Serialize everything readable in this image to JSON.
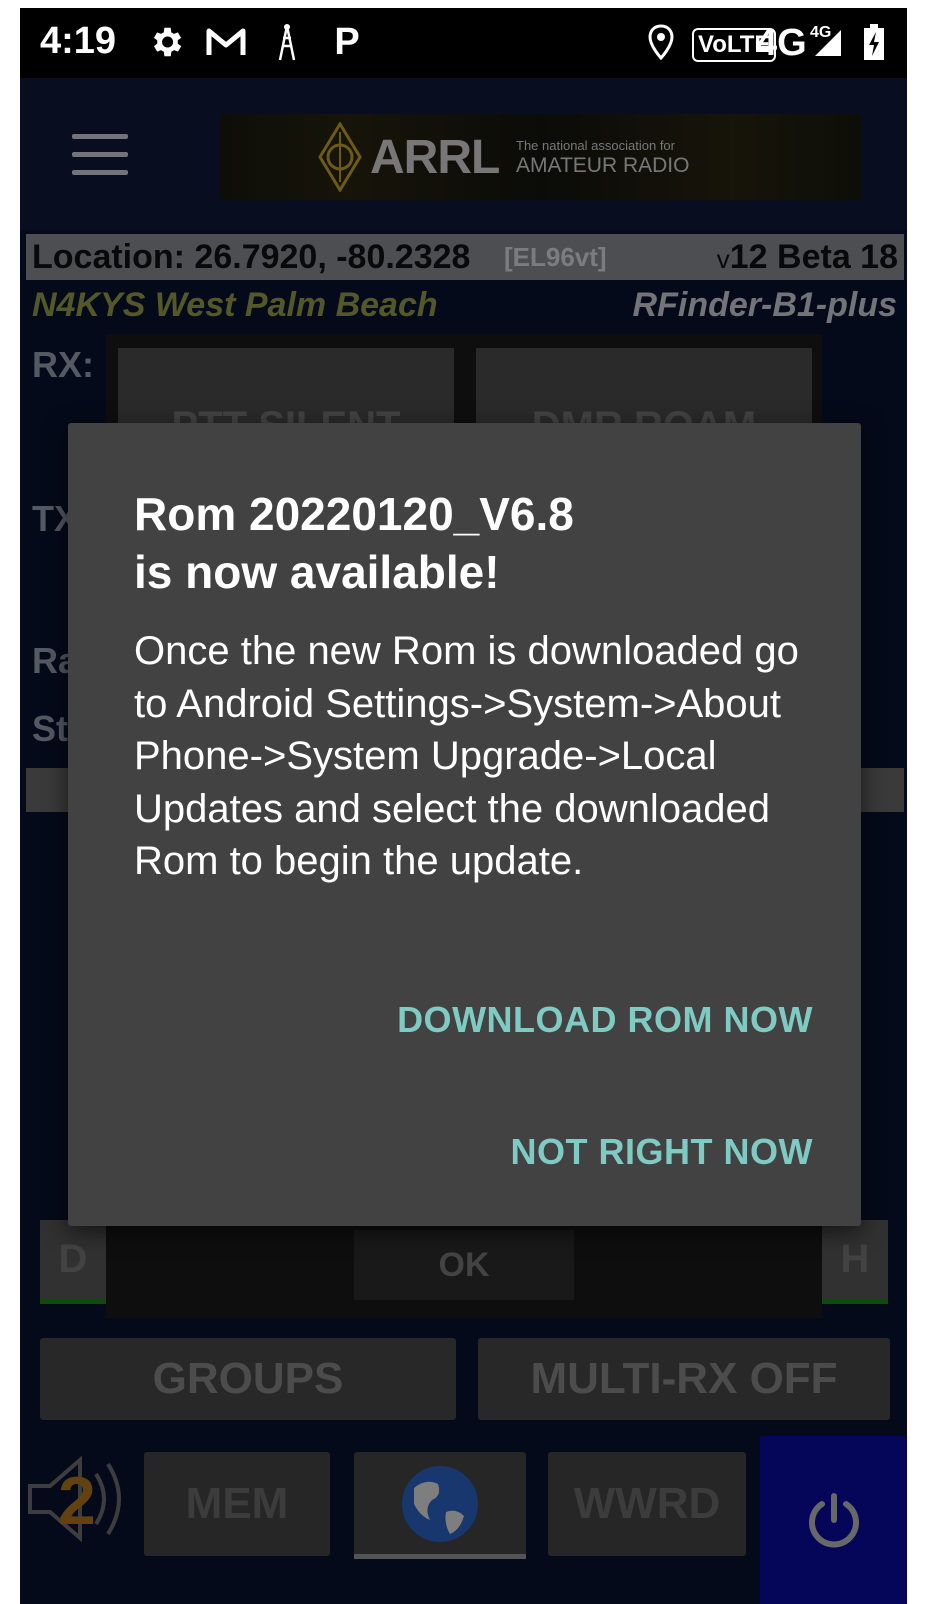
{
  "status_bar": {
    "time": "4:19",
    "icons": [
      "gear-icon",
      "gmail-icon",
      "radio-tower-icon",
      "parking-icon",
      "location-icon",
      "volte-icon",
      "signal-icon",
      "battery-icon"
    ],
    "volte": "VoLTE",
    "network": "4G",
    "network_small": "4G"
  },
  "header": {
    "banner_title": "ARRL",
    "banner_tagline": "The national association for",
    "banner_subtitle": "AMATEUR RADIO"
  },
  "info": {
    "location": "Location: 26.7920, -80.2328",
    "grid": "[EL96vt]",
    "version_prefix": "v",
    "version": "12 Beta 18",
    "callsign": "N4KYS West Palm Beach",
    "device": "RFinder-B1-plus"
  },
  "background": {
    "rx_label": "RX:",
    "tx_label": "TX",
    "ra_label": "Ra",
    "st_label": "St",
    "btn_ptt": "PTT SILENT",
    "btn_dmr": "DMR ROAM",
    "btn_ok": "OK",
    "btn_d": "D",
    "btn_h": "H"
  },
  "dialog": {
    "title_line1": "Rom 20220120_V6.8",
    "title_line2": "is now available!",
    "body": "Once the new Rom is downloaded go to Android Settings->System->About Phone->System Upgrade->Local Updates and select the downloaded Rom to begin the update.",
    "download_button": "DOWNLOAD ROM NOW",
    "dismiss_button": "NOT RIGHT NOW"
  },
  "bottom": {
    "groups": "GROUPS",
    "multi_rx": "MULTI-RX OFF",
    "volume_level": "2",
    "mem": "MEM",
    "wwrd": "WWRD"
  },
  "colors": {
    "accent": "#7fcbc4",
    "dialog_bg": "#424242",
    "power_bg": "#0a0aa5",
    "callsign": "#9aa049"
  }
}
